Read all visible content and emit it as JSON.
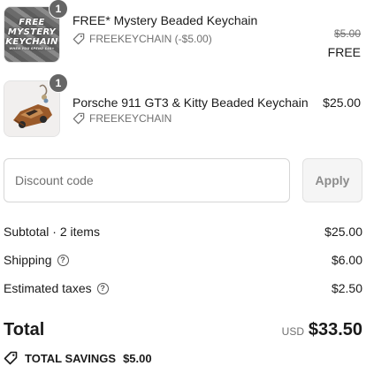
{
  "items": [
    {
      "title": "FREE* Mystery Beaded Keychain",
      "quantity": "1",
      "discount_text": "FREEKEYCHAIN (-$5.00)",
      "compare_price": "$5.00",
      "price": "FREE",
      "thumb_text": [
        "FREE",
        "MYSTERY",
        "KEYCHAIN"
      ],
      "thumb_small": "WHEN YOU SPEND $40+"
    },
    {
      "title": "Porsche 911 GT3 & Kitty Beaded Keychain",
      "quantity": "1",
      "discount_text": "FREEKEYCHAIN",
      "price": "$25.00"
    }
  ],
  "discount": {
    "placeholder": "Discount code",
    "apply_label": "Apply"
  },
  "summary": {
    "subtotal_label": "Subtotal · 2 items",
    "subtotal_value": "$25.00",
    "shipping_label": "Shipping",
    "shipping_value": "$6.00",
    "taxes_label": "Estimated taxes",
    "taxes_value": "$2.50",
    "help_glyph": "?"
  },
  "total": {
    "label": "Total",
    "currency": "USD",
    "value": "$33.50"
  },
  "savings": {
    "label": "TOTAL SAVINGS",
    "value": "$5.00"
  },
  "icons": {
    "tag": "tag-icon",
    "help": "help-circle-icon"
  },
  "colors": {
    "text": "#1a1a1a",
    "muted": "#707070",
    "badge": "#666666",
    "button_bg": "#f5f5f5"
  }
}
